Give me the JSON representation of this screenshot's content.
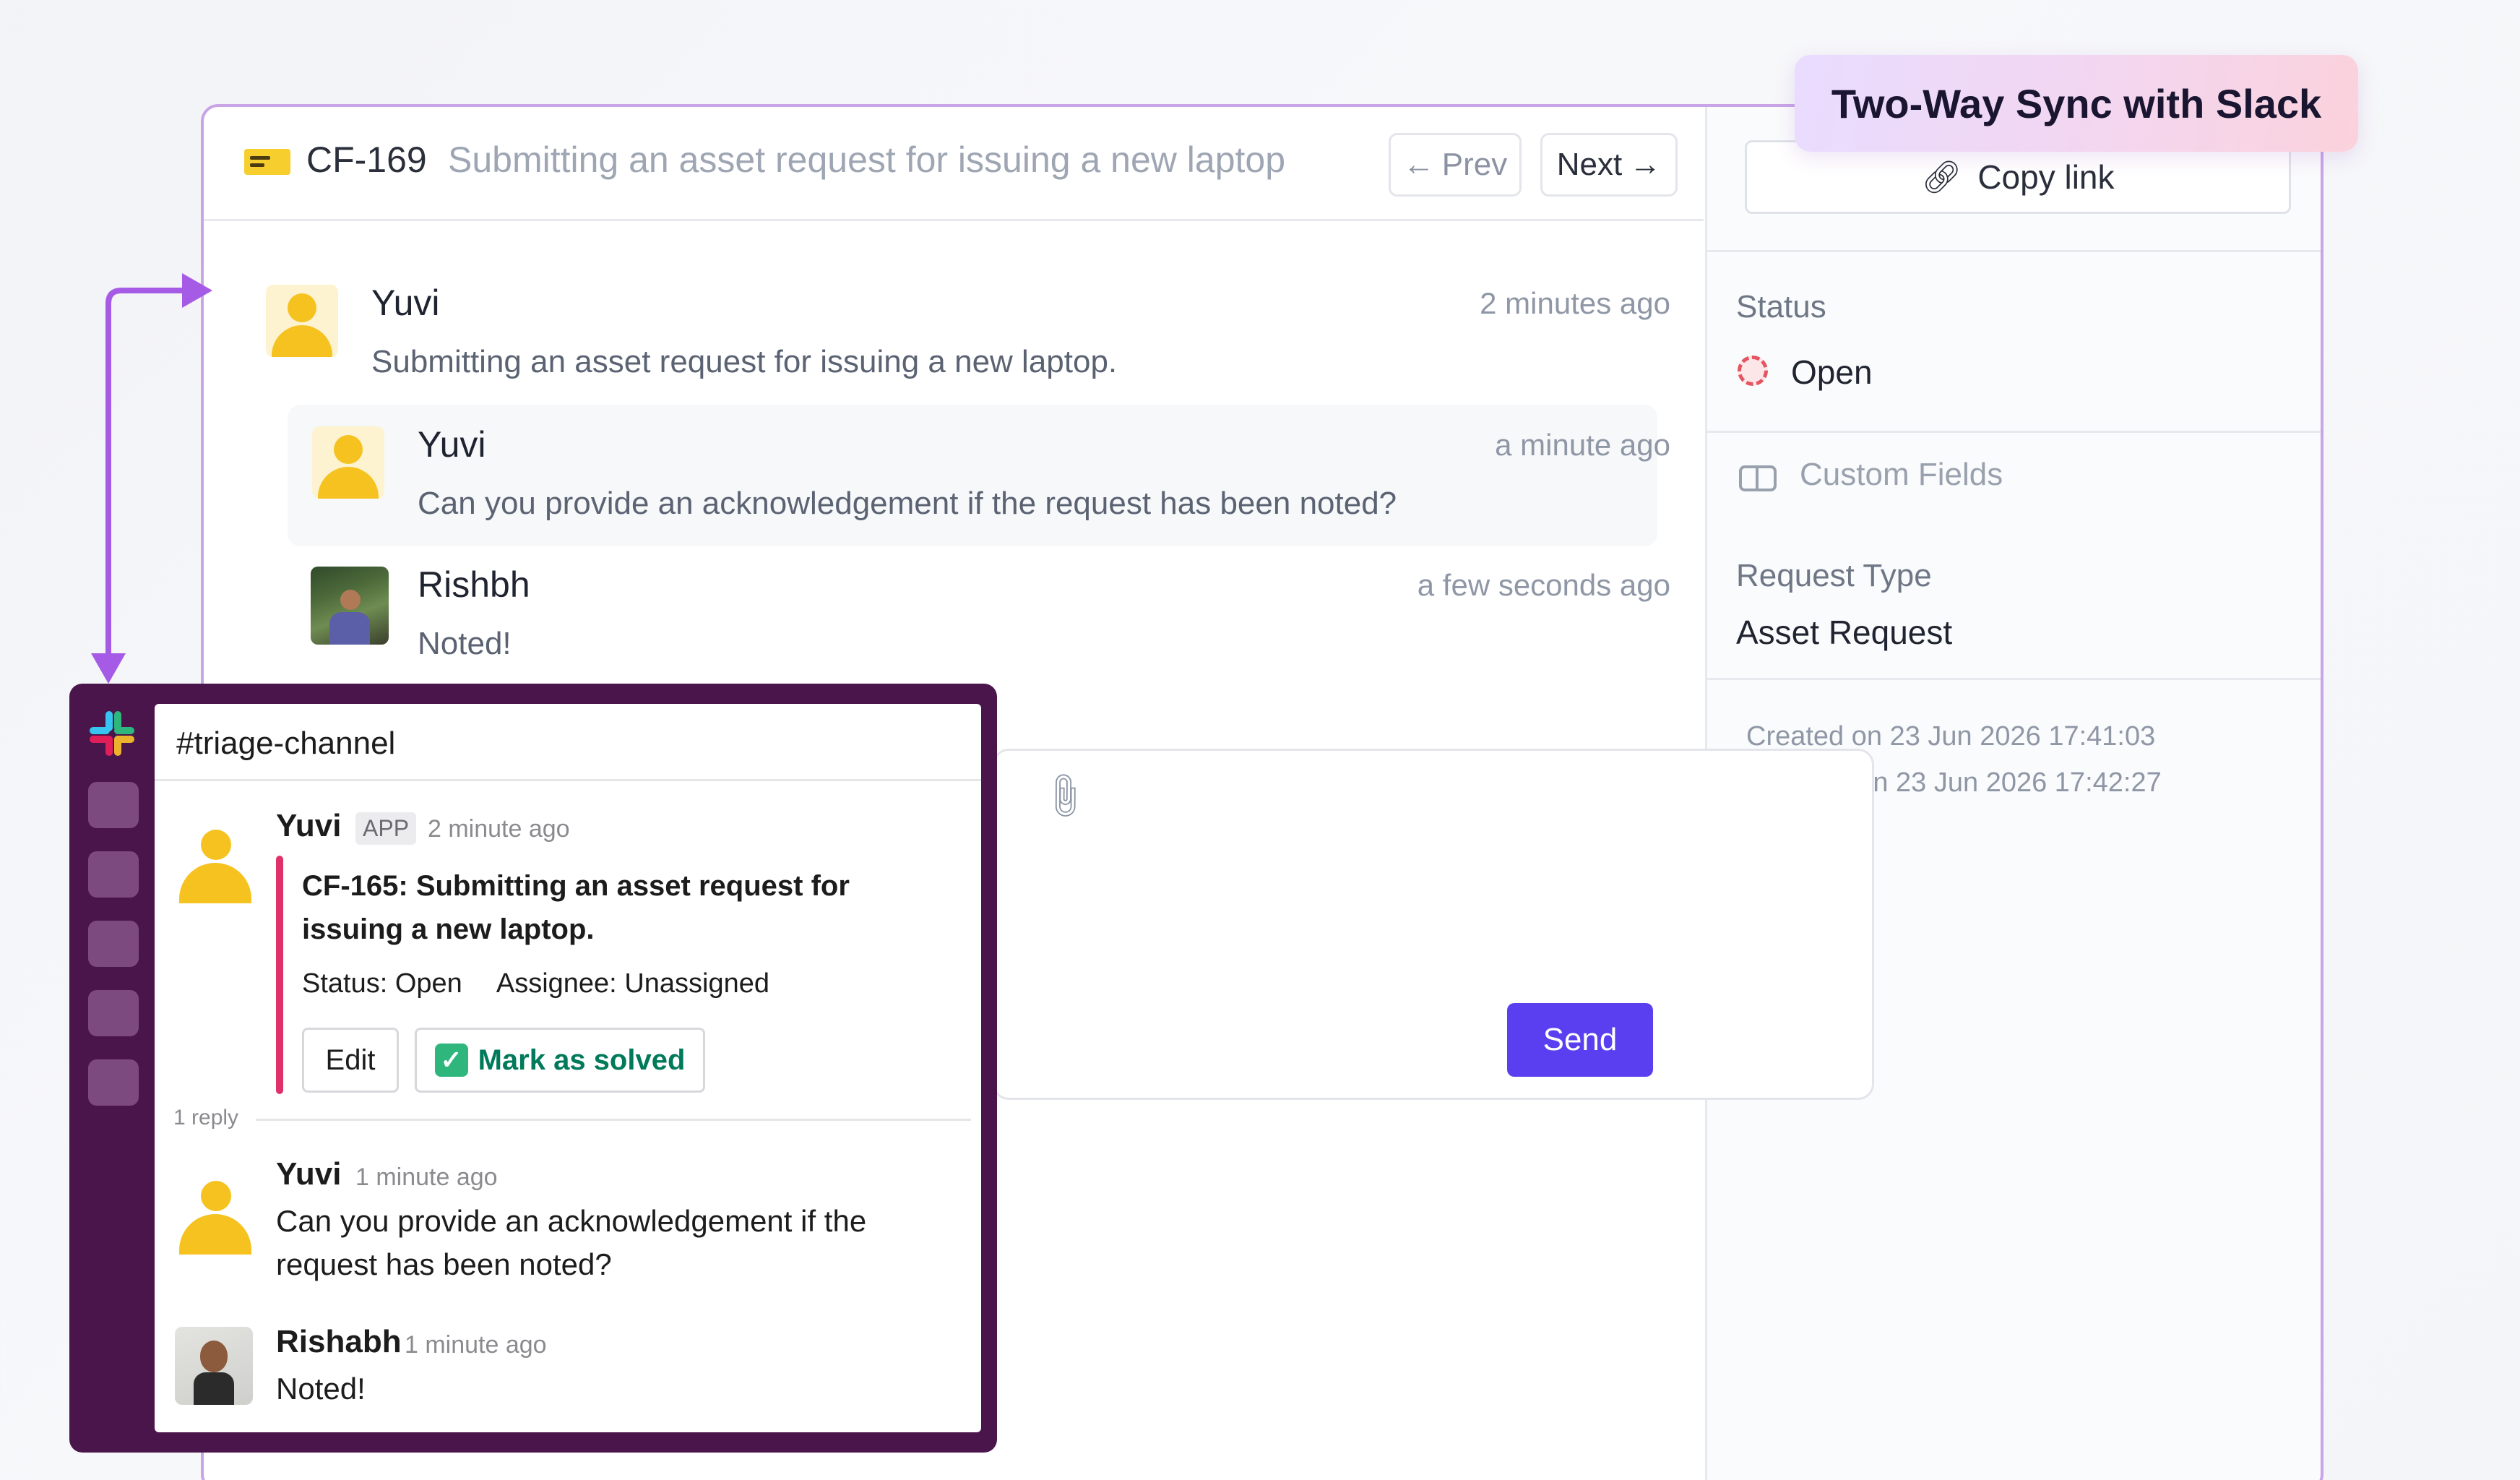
{
  "badge": {
    "label": "Two-Way Sync with Slack"
  },
  "ticket": {
    "id": "CF-169",
    "title": "Submitting an asset request for issuing a new laptop",
    "prev_label": "Prev",
    "next_label": "Next"
  },
  "messages": [
    {
      "author": "Yuvi",
      "time": "2 minutes ago",
      "text": "Submitting an asset request for issuing a new laptop."
    },
    {
      "author": "Yuvi",
      "time": "a minute ago",
      "text": "Can you provide an acknowledgement if the request has been noted?"
    },
    {
      "author": "Rishbh",
      "time": "a few seconds ago",
      "text": "Noted!"
    }
  ],
  "composer": {
    "send_label": "Send"
  },
  "sidebar": {
    "copy_link_label": "Copy link",
    "status_label": "Status",
    "status_value": "Open",
    "custom_fields_label": "Custom Fields",
    "request_type_label": "Request Type",
    "request_type_value": "Asset Request",
    "created": "Created on 23 Jun 2026 17:41:03",
    "updated": "Updated on 23 Jun 2026 17:42:27"
  },
  "slack": {
    "channel": "#triage-channel",
    "app_message": {
      "author": "Yuvi",
      "badge": "APP",
      "time": "2 minute ago",
      "card_title": "CF-165: Submitting an asset request for issuing a new laptop.",
      "status_label": "Status:",
      "status_value": "Open",
      "assignee_label": "Assignee:",
      "assignee_value": "Unassigned",
      "edit_label": "Edit",
      "solve_label": "Mark as solved"
    },
    "reply_count": "1 reply",
    "replies": [
      {
        "author": "Yuvi",
        "time": "1 minute ago",
        "text": "Can you provide an acknowledgement if the request has been noted?"
      },
      {
        "author": "Rishabh",
        "time": "1 minute ago",
        "text": "Noted!"
      }
    ]
  },
  "colors": {
    "accent": "#5a3ff0",
    "slack_sidebar": "#4a154b",
    "window_border": "#c9a4e6",
    "arrow": "#a65be6",
    "status_open": "#e25561",
    "solve_green": "#007a5a"
  },
  "icons": [
    "ticket-flag-icon",
    "arrow-left-icon",
    "arrow-right-icon",
    "link-icon",
    "status-open-icon",
    "custom-fields-icon",
    "paperclip-icon",
    "slack-logo-icon",
    "check-icon"
  ]
}
